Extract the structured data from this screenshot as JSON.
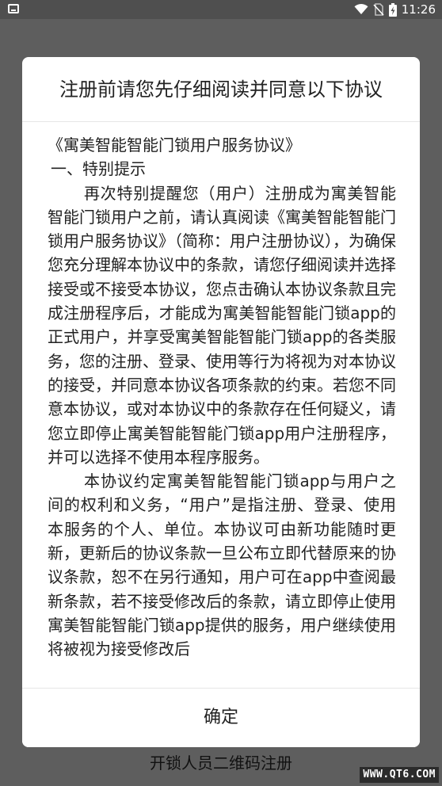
{
  "status_bar": {
    "time": "11:26",
    "icons": [
      "screen-icon",
      "wifi-icon",
      "no-sim-icon",
      "battery-charging-icon"
    ]
  },
  "dialog": {
    "title": "注册前请您先仔细阅读并同意以下协议",
    "content": {
      "doc_title": "《寓美智能智能门锁用户服务协议》",
      "section_1_heading": "一、特别提示",
      "paragraph_1": "再次特别提醒您（用户）注册成为寓美智能智能门锁用户之前，请认真阅读《寓美智能智能门锁用户服务协议》（简称：用户注册协议），为确保您充分理解本协议中的条款，请您仔细阅读并选择接受或不接受本协议，您点击确认本协议条款且完成注册程序后，才能成为寓美智能智能门锁app的正式用户，并享受寓美智能智能门锁app的各类服务，您的注册、登录、使用等行为将视为对本协议的接受，并同意本协议各项条款的约束。若您不同意本协议，或对本协议中的条款存在任何疑义，请您立即停止寓美智能智能门锁app用户注册程序，并可以选择不使用本程序服务。",
      "paragraph_2": "本协议约定寓美智能智能门锁app与用户之间的权利和义务，“用户”是指注册、登录、使用本服务的个人、单位。本协议可由新功能随时更新，更新后的协议条款一旦公布立即代替原来的协议条款，恕不在另行通知，用户可在app中查阅最新条款，若不接受修改后的条款，请立即停止使用寓美智能智能门锁app提供的服务，用户继续使用将被视为接受修改后"
    },
    "confirm_label": "确定"
  },
  "bottom_link": "开锁人员二维码注册",
  "watermark": "WWW.QT6.COM"
}
